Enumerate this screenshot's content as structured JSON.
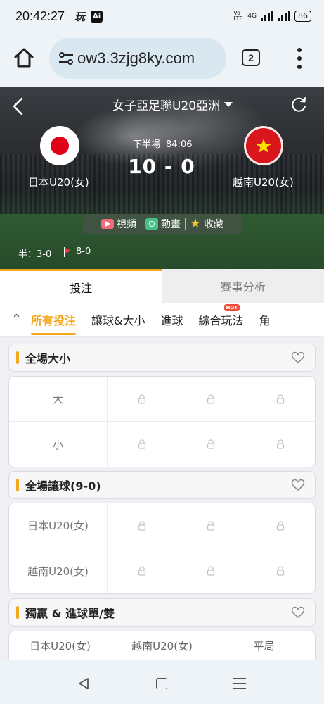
{
  "status_bar": {
    "time": "20:42:27",
    "app_icon_1": "玩",
    "app_icon_2": "Ai",
    "volte": "Vo LTE",
    "network": "4G",
    "battery": "86"
  },
  "browser": {
    "url": "ow3.3zjg8ky.com",
    "tab_count": "2",
    "icons": [
      "home-icon",
      "site-settings-icon",
      "tabs-icon",
      "more-icon"
    ]
  },
  "match": {
    "league": "女子亞足聯U20亞洲",
    "home_team": "日本U20(女)",
    "away_team": "越南U20(女)",
    "period": "下半場",
    "clock": "84:06",
    "score": "10 - 0",
    "half_time": "半：3-0",
    "corners": "8-0",
    "video_label": "視頻",
    "animation_label": "動畫",
    "favorite_label": "收藏"
  },
  "main_tabs": [
    "投注",
    "賽事分析"
  ],
  "sub_tabs": [
    "所有投注",
    "讓球&大小",
    "進球",
    "綜合玩法",
    "角"
  ],
  "hot_badge": "HOT",
  "sections": [
    {
      "title": "全場大小",
      "rows": [
        "大",
        "小"
      ]
    },
    {
      "title": "全場讓球(9-0)",
      "rows": [
        "日本U20(女)",
        "越南U20(女)"
      ]
    },
    {
      "title": "獨贏 & 進球單/雙",
      "columns": [
        "日本U20(女)",
        "越南U20(女)",
        "平局"
      ]
    }
  ],
  "colors": {
    "accent": "#f3a71c",
    "hot": "#f04d3a",
    "vn_flag": "#d8161b",
    "jp_dot": "#e00018"
  }
}
